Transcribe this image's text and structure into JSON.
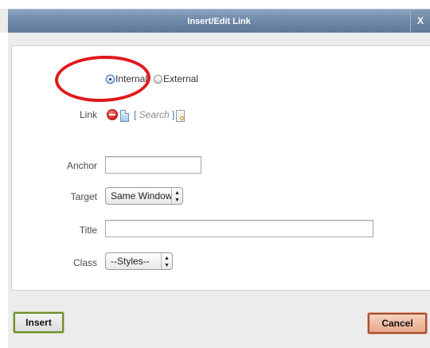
{
  "dialog": {
    "title": "Insert/Edit Link",
    "close_label": "X"
  },
  "link_type": {
    "options": [
      {
        "label": "Internal",
        "checked": true
      },
      {
        "label": "External",
        "checked": false
      }
    ]
  },
  "link": {
    "label": "Link",
    "search_open": "[ ",
    "search_text": "Search",
    "search_close": " ]"
  },
  "anchor": {
    "label": "Anchor",
    "value": ""
  },
  "target": {
    "label": "Target",
    "selected": "Same Window"
  },
  "title_field": {
    "label": "Title",
    "value": ""
  },
  "class_field": {
    "label": "Class",
    "selected": "--Styles--"
  },
  "buttons": {
    "insert": "Insert",
    "cancel": "Cancel"
  },
  "colors": {
    "highlight": "#e0191b",
    "titlebar": "#6f8aaa",
    "insert_border": "#6f8c2f",
    "cancel_bg": "#e7a888"
  }
}
